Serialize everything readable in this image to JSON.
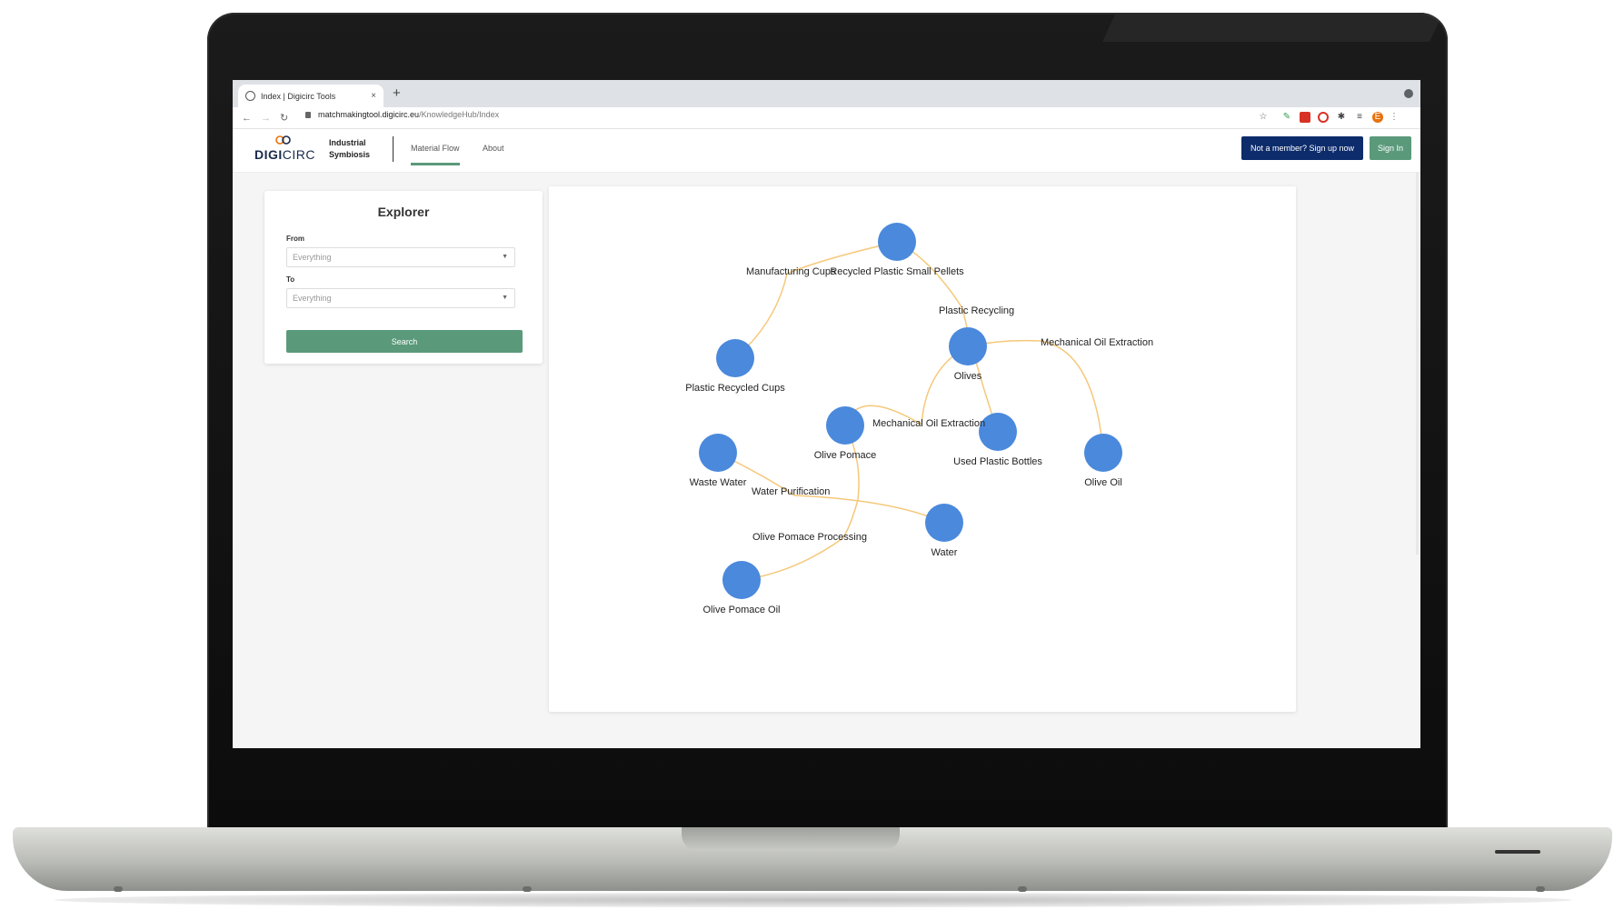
{
  "browser": {
    "tab_title": "Index | Digicirc Tools",
    "tab_close": "×",
    "new_tab": "+",
    "url_host": "matchmakingtool.digicirc.eu",
    "url_path": "/KnowledgeHub/Index",
    "avatar_letter": "E"
  },
  "nav": {
    "logo_bold": "DIGI",
    "logo_light": "CIRC",
    "subtitle": "Industrial Symbiosis",
    "links": [
      "Material Flow",
      "About"
    ],
    "signup_label": "Not a member? Sign up now",
    "signin_label": "Sign In"
  },
  "explorer": {
    "title": "Explorer",
    "from_label": "From",
    "from_value": "Everything",
    "to_label": "To",
    "to_value": "Everything",
    "search_label": "Search"
  },
  "graph": {
    "node_color": "#4a89dc",
    "edge_color": "#f5c87a",
    "nodes": [
      {
        "id": "pellets",
        "label": "Recycled Plastic Small Pellets"
      },
      {
        "id": "cups",
        "label": "Plastic Recycled Cups"
      },
      {
        "id": "olives",
        "label": "Olives"
      },
      {
        "id": "pomace",
        "label": "Olive Pomace"
      },
      {
        "id": "bottles",
        "label": "Used Plastic Bottles"
      },
      {
        "id": "oliveoil",
        "label": "Olive Oil"
      },
      {
        "id": "waste",
        "label": "Waste Water"
      },
      {
        "id": "water",
        "label": "Water"
      },
      {
        "id": "pomaceoil",
        "label": "Olive Pomace Oil"
      }
    ],
    "process_labels": [
      "Manufacturing Cups",
      "Plastic Recycling",
      "Mechanical Oil Extraction",
      "Mechanical Oil Extraction",
      "Water Purification",
      "Olive Pomace Processing"
    ]
  }
}
